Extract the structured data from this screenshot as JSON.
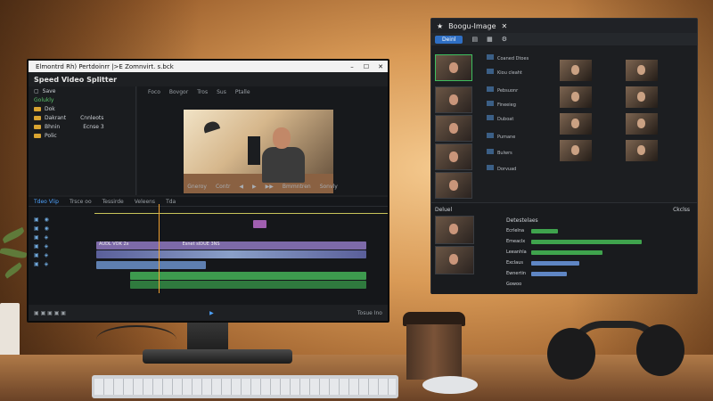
{
  "monitor": {
    "window_title": "Elmontrd Rh) Pertdoinrr |>E Zomnvirt. s.bck",
    "app_title": "Speed Video Splitter",
    "left_panel": {
      "header": "Save",
      "section": "Golukly",
      "items": [
        "Dok",
        "Dakrant",
        "Bhnin",
        "Polic"
      ],
      "right_items": [
        "Cnnleots",
        "Ecnse 3"
      ]
    },
    "preview_tabs": [
      "Sale",
      "Coraim",
      "Sage",
      "Sous"
    ],
    "preview_menu": [
      "Foco",
      "Bovgor",
      "Tros",
      "Sus",
      "Ptalle"
    ],
    "preview_controls": [
      "Gneroy",
      "Contr",
      "Sonteent",
      "Eeaten",
      "Bmmntren",
      "Sonvly"
    ],
    "timeline_tabs": [
      "Tdeo Vlip",
      "Trsce oo",
      "Tessirde",
      "Veleens",
      "Tda"
    ],
    "clip_labels": [
      "AUDL VOK 2x",
      "Esnet sIDUE 3NS"
    ],
    "status_right": "Tosue Ino"
  },
  "right_window": {
    "title": "Boogu-Image",
    "tool_button": "Deinl",
    "list_items": [
      "Coaned Dtoes",
      "Kiou cleaht",
      "Pebsuonr",
      "Fineeieg",
      "Duboat",
      "Pumane",
      "Bulwrs",
      "Dorvuad"
    ],
    "lower_header": "Deluel",
    "lower_right": "Ckclss",
    "bars_header": "Detestelaes",
    "bar_labels": [
      "Ecrlelna",
      "Emeaclx",
      "Leeanhla",
      "Exclaus",
      "Ewnertin"
    ],
    "footer": "Gowoo"
  },
  "colors": {
    "accent_blue": "#2f6fc4",
    "selection_green": "#3fbf5f",
    "track_purple": "#7d6aa8",
    "track_green": "#3d9a4e"
  }
}
